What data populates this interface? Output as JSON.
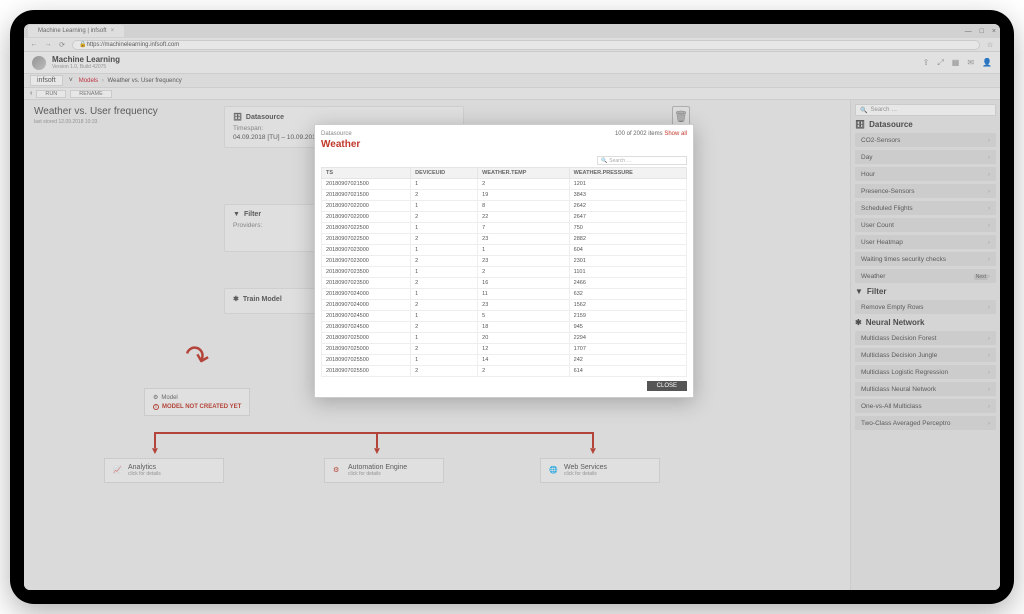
{
  "browser": {
    "tab_title": "Machine Learning | infsoft",
    "url": "https://machinelearning.infsoft.com",
    "win_min": "—",
    "win_max": "□",
    "win_close": "×"
  },
  "app": {
    "title": "Machine Learning",
    "subtitle": "Version 1.0, Build 42075",
    "brand": "infsoft",
    "chevron": "˅"
  },
  "breadcrumb": {
    "models": "Models",
    "sep": "›",
    "current": "Weather vs. User frequency"
  },
  "bar2": {
    "chev": "‹",
    "run": "RUN",
    "rename": "RENAME"
  },
  "page": {
    "title": "Weather vs. User frequency",
    "subtitle": "last stored 12.09.2018 10:33"
  },
  "panels": {
    "datasource": {
      "heading": "Datasource",
      "timespan_label": "Timespan:",
      "timespan_value": "04.09.2018 [TU] – 10.09.2018 [MO]"
    },
    "filter": {
      "heading": "Filter",
      "providers_label": "Providers:"
    },
    "train": {
      "heading": "Train Model"
    }
  },
  "model_node": {
    "heading": "Model",
    "error": "MODEL NOT CREATED YET"
  },
  "leaves": {
    "analytics": {
      "title": "Analytics",
      "sub": "click for details"
    },
    "automation": {
      "title": "Automation Engine",
      "sub": "click for details"
    },
    "webservices": {
      "title": "Web Services",
      "sub": "click for details"
    }
  },
  "sidebar": {
    "search_placeholder": "Search …",
    "sections": {
      "datasource": "Datasource",
      "filter": "Filter",
      "neural": "Neural  Network"
    },
    "ds_items": [
      "CO2-Sensors",
      "Day",
      "Hour",
      "Presence-Sensors",
      "Scheduled Flights",
      "User Count",
      "User Heatmap",
      "Waiting times security checks",
      "Weather"
    ],
    "weather_tag": "Next",
    "filter_items": [
      "Remove Empty Rows"
    ],
    "nn_items": [
      "Multiclass Decision Forest",
      "Multiclass Decision Jungle",
      "Multiclass Logistic Regression",
      "Multiclass Neural Network",
      "One-vs-All Multiclass",
      "Two-Class Averaged Perceptro"
    ]
  },
  "modal": {
    "label": "Datasource",
    "title": "Weather",
    "count_prefix": "100 of 2002 items ",
    "show_all": "Show all",
    "search_placeholder": "Search …",
    "close": "CLOSE",
    "headers": [
      "TS",
      "DEVICEUID",
      "WEATHER.TEMP",
      "WEATHER.PRESSURE"
    ],
    "rows": [
      [
        "20180907021500",
        "1",
        "2",
        "1201"
      ],
      [
        "20180907021500",
        "2",
        "19",
        "3843"
      ],
      [
        "20180907022000",
        "1",
        "8",
        "2642"
      ],
      [
        "20180907022000",
        "2",
        "22",
        "2647"
      ],
      [
        "20180907022500",
        "1",
        "7",
        "750"
      ],
      [
        "20180907022500",
        "2",
        "23",
        "2882"
      ],
      [
        "20180907023000",
        "1",
        "1",
        "604"
      ],
      [
        "20180907023000",
        "2",
        "23",
        "2301"
      ],
      [
        "20180907023500",
        "1",
        "2",
        "1101"
      ],
      [
        "20180907023500",
        "2",
        "16",
        "2466"
      ],
      [
        "20180907024000",
        "1",
        "11",
        "632"
      ],
      [
        "20180907024000",
        "2",
        "23",
        "1562"
      ],
      [
        "20180907024500",
        "1",
        "5",
        "2159"
      ],
      [
        "20180907024500",
        "2",
        "18",
        "945"
      ],
      [
        "20180907025000",
        "1",
        "20",
        "2294"
      ],
      [
        "20180907025000",
        "2",
        "12",
        "1707"
      ],
      [
        "20180907025500",
        "1",
        "14",
        "242"
      ],
      [
        "20180907025500",
        "2",
        "2",
        "614"
      ]
    ]
  }
}
